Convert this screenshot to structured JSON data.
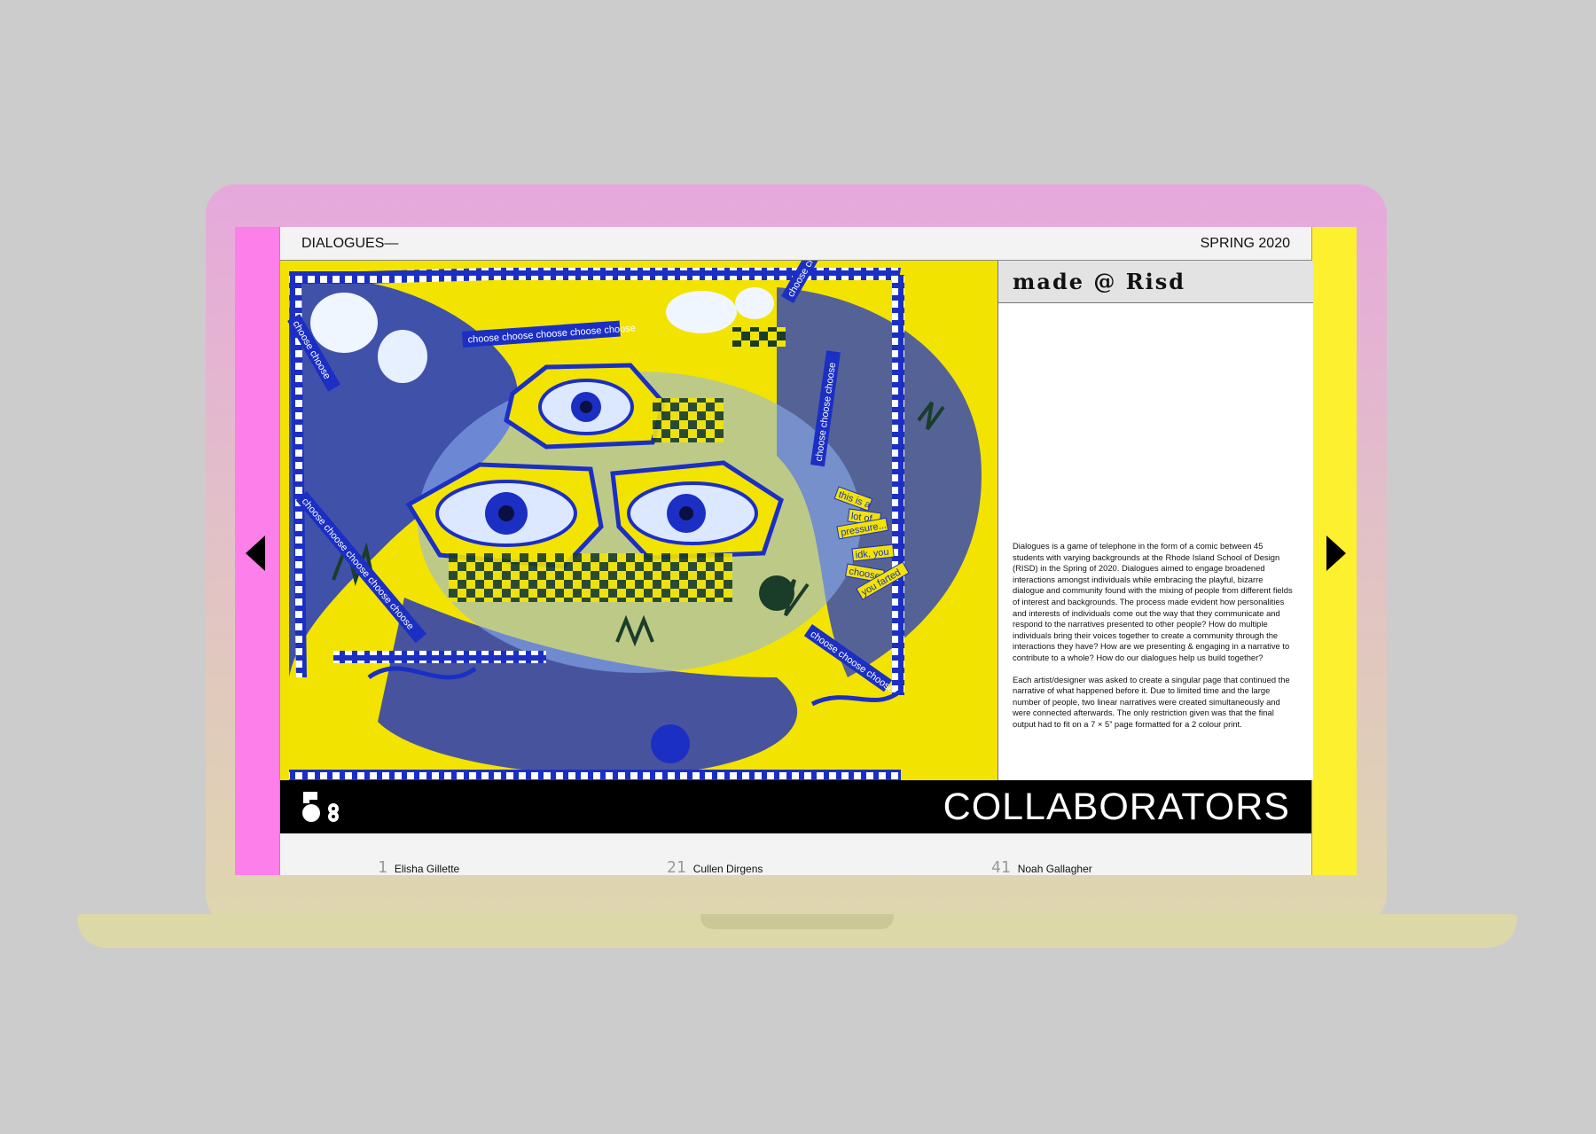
{
  "header": {
    "title": "DIALOGUES—",
    "season": "SPRING 2020"
  },
  "artwork": {
    "labels": {
      "choose_long": "choose choose choose choose choose",
      "choose_short": "choose choose",
      "choose_mid": "choose choose choose",
      "pressure_1": "this is a",
      "pressure_2": "lot of",
      "pressure_3": "pressure...",
      "idk_1": "idk, you",
      "idk_2": "choose",
      "farted": "you farted"
    }
  },
  "sidebar": {
    "logo_text": "made @ Risd",
    "paragraph1": "Dialogues is a game of telephone in the form of a comic between 45 students with varying backgrounds at the Rhode Island School of Design (RISD) in the Spring of 2020. Dialogues aimed to engage broadened interactions amongst individuals while embracing the playful, bizarre dialogue and community found with the mixing of people from different fields of interest and backgrounds. The process made evident how personalities and interests of individuals come out the way that they communicate and respond to the narratives presented to other people? How do multiple individuals bring their voices together to create a community through the interactions they have? How are we presenting & engaging in a narrative to contribute to a whole? How do our dialogues help us build together?",
    "paragraph2": "Each artist/designer was asked to create a singular page that continued the narrative of what happened before it. Due to limited time and the large number of people, two linear narratives were created simultaneously and were connected afterwards. The only restriction given was that the final output had to fit on a 7 × 5” page formatted for a 2 colour print."
  },
  "collaborators": {
    "title": "COLLABORATORS",
    "items": [
      {
        "num": "1",
        "name": "Elisha Gillette"
      },
      {
        "num": "21",
        "name": "Cullen Dirgens"
      },
      {
        "num": "41",
        "name": "Noah Gallagher"
      }
    ]
  },
  "nav": {
    "prev_icon": "triangle-left-icon",
    "next_icon": "triangle-right-icon"
  },
  "colors": {
    "lid": "#e6a8dc",
    "base": "#dcd8a8",
    "rail_left": "#fd7fe9",
    "rail_right": "#fdf02e",
    "art_yellow": "#f3e300",
    "art_blue": "#1b2fc4"
  }
}
